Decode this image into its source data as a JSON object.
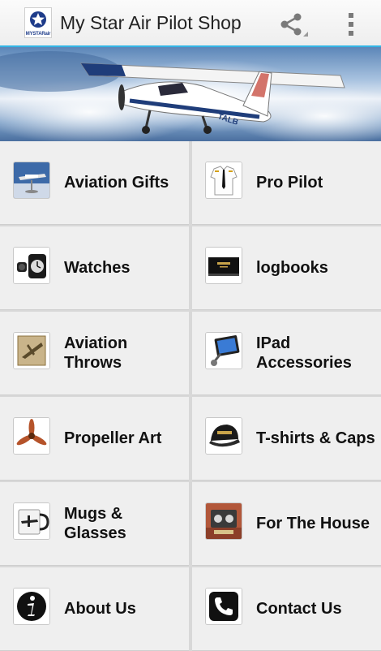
{
  "app": {
    "title": "My Star Air Pilot Shop",
    "logo_text": "MYSTARair",
    "accent_color": "#33b5e5"
  },
  "actions": {
    "share_icon": "share-icon",
    "overflow_icon": "overflow-menu-icon"
  },
  "banner": {
    "aircraft_registration": "TALB"
  },
  "tiles": [
    {
      "label": "Aviation Gifts",
      "icon": "airplane-gift-icon"
    },
    {
      "label": "Pro Pilot",
      "icon": "pilot-shirt-icon"
    },
    {
      "label": "Watches",
      "icon": "watch-icon"
    },
    {
      "label": "logbooks",
      "icon": "logbook-icon"
    },
    {
      "label": "Aviation\nThrows",
      "icon": "blanket-icon"
    },
    {
      "label": "IPad\nAccessories",
      "icon": "tablet-mount-icon"
    },
    {
      "label": "Propeller Art",
      "icon": "propeller-icon"
    },
    {
      "label": "T-shirts & Caps",
      "icon": "cap-icon"
    },
    {
      "label": "Mugs & Glasses",
      "icon": "mug-icon"
    },
    {
      "label": "For The House",
      "icon": "house-decor-icon"
    },
    {
      "label": "About Us",
      "icon": "info-icon"
    },
    {
      "label": "Contact Us",
      "icon": "phone-icon"
    }
  ]
}
